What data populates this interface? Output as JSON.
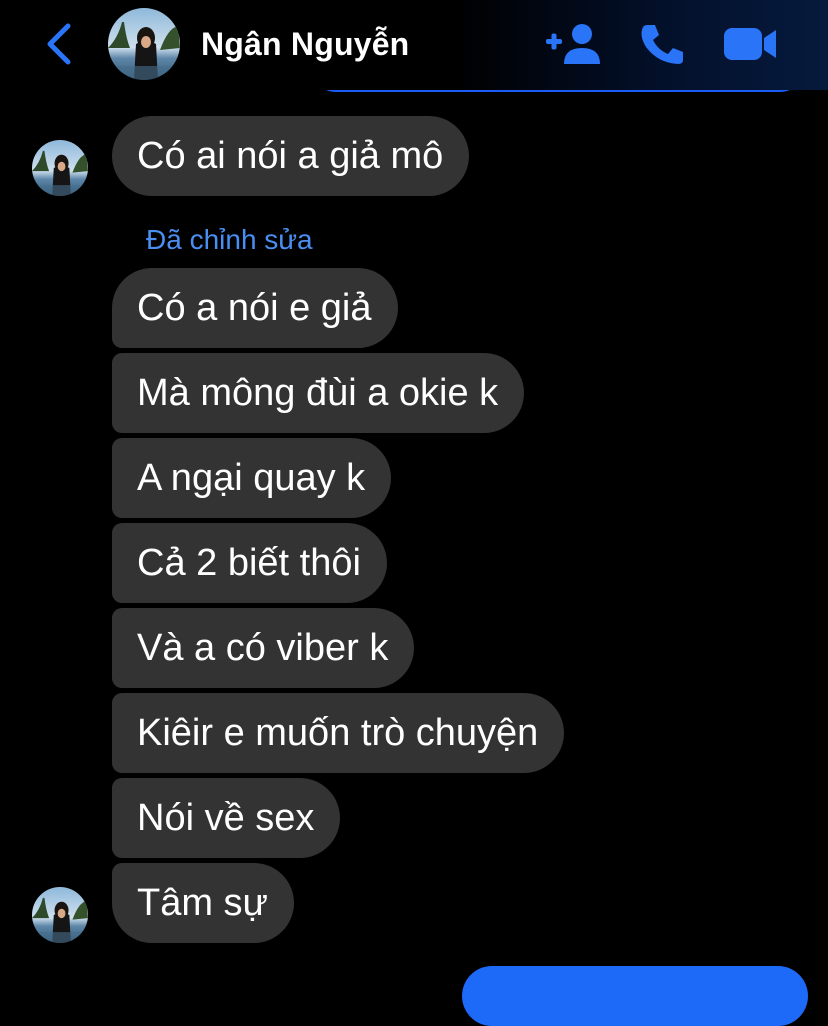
{
  "header": {
    "back_icon": "chevron-left-icon",
    "contact_name": "Ngân Nguyễn",
    "actions": [
      "add-person-icon",
      "phone-icon",
      "video-camera-icon"
    ],
    "accent_color": "#2a74f7"
  },
  "messages": {
    "first": "Có ai nói a giả mô",
    "edited_label": "Đã chỉnh sửa",
    "group": [
      "Có a nói e giả",
      "Mà mông đùi a okie k",
      "A ngại quay k",
      "Cả 2 biết thôi",
      "Và a có viber k",
      "Kiêir e muốn trò chuyện",
      "Nói về sex",
      "Tâm sự"
    ]
  },
  "colors": {
    "background": "#000000",
    "received_bubble": "#333333",
    "sent_bubble": "#1e6af8",
    "edited_label": "#4a8ef2"
  }
}
